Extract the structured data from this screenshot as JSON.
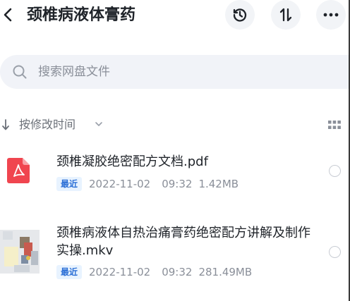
{
  "header": {
    "back_icon": "chevron-left-icon",
    "title": "颈椎病液体膏药",
    "actions": [
      {
        "icon": "history-icon"
      },
      {
        "icon": "sort-arrows-icon"
      },
      {
        "icon": "more-icon"
      }
    ]
  },
  "search": {
    "icon": "search-icon",
    "placeholder": "搜索网盘文件",
    "value": ""
  },
  "sort": {
    "icon": "arrow-down-icon",
    "label": "按修改时间",
    "caret_icon": "chevron-down-icon",
    "view_icon": "grid-view-icon"
  },
  "files": [
    {
      "icon": "pdf-file-icon",
      "name": "颈椎凝胶绝密配方文档.pdf",
      "badge": "最近",
      "date": "2022-11-02",
      "time": "09:32",
      "size": "1.42MB",
      "selected": false
    },
    {
      "icon": "video-thumbnail",
      "name": "颈椎病液体自热治痛膏药绝密配方讲解及制作实操.mkv",
      "badge": "最近",
      "date": "2022-11-02",
      "time": "09:32",
      "size": "281.49MB",
      "selected": false
    }
  ],
  "colors": {
    "pdf_red": "#f0454f",
    "badge_bg": "#e8f3ff",
    "badge_text": "#2b6fd6",
    "search_bg": "#f1f3f8",
    "meta_gray": "#8a8f99"
  }
}
